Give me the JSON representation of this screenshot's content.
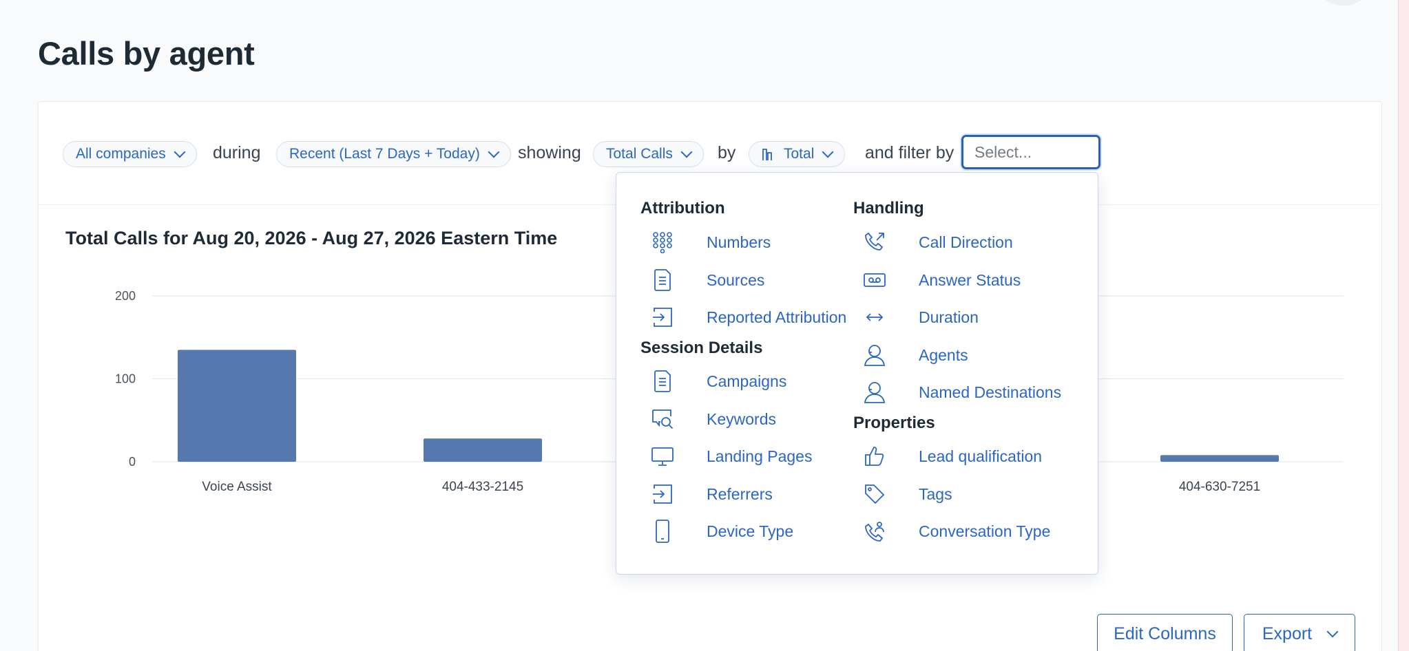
{
  "page": {
    "title": "Calls by agent"
  },
  "filters": {
    "company": "All companies",
    "during_label": "during",
    "date_range": "Recent (Last 7 Days + Today)",
    "showing_label": "showing",
    "metric": "Total Calls",
    "by_label": "by",
    "group": "Total",
    "filter_label": "and filter by",
    "select_placeholder": "Select..."
  },
  "dropdown": {
    "sections": {
      "attribution": "Attribution",
      "session_details": "Session Details",
      "handling": "Handling",
      "properties": "Properties"
    },
    "attribution_items": [
      {
        "label": "Numbers",
        "icon": "numbers-grid-icon"
      },
      {
        "label": "Sources",
        "icon": "document-icon"
      },
      {
        "label": "Reported Attribution",
        "icon": "sign-in-arrow-icon"
      }
    ],
    "session_items": [
      {
        "label": "Campaigns",
        "icon": "document-icon"
      },
      {
        "label": "Keywords",
        "icon": "search-chat-icon"
      },
      {
        "label": "Landing Pages",
        "icon": "monitor-icon"
      },
      {
        "label": "Referrers",
        "icon": "sign-in-arrow-icon"
      },
      {
        "label": "Device Type",
        "icon": "mobile-phone-icon"
      }
    ],
    "handling_items": [
      {
        "label": "Call Direction",
        "icon": "phone-outgoing-icon"
      },
      {
        "label": "Answer Status",
        "icon": "voicemail-icon"
      },
      {
        "label": "Duration",
        "icon": "double-arrow-icon"
      },
      {
        "label": "Agents",
        "icon": "agent-user-icon"
      },
      {
        "label": "Named Destinations",
        "icon": "agent-user-icon"
      }
    ],
    "properties_items": [
      {
        "label": "Lead qualification",
        "icon": "thumbs-up-icon"
      },
      {
        "label": "Tags",
        "icon": "tag-icon"
      },
      {
        "label": "Conversation Type",
        "icon": "phone-person-icon"
      }
    ]
  },
  "chart_data": {
    "type": "bar",
    "title": "Total Calls for Aug 20, 2026 - Aug 27, 2026 Eastern Time",
    "categories": [
      "Voice Assist",
      "404-433-2145",
      "404-630-7251"
    ],
    "values": [
      135,
      28,
      8
    ],
    "yticks": [
      0,
      100,
      200
    ],
    "ylim": [
      0,
      200
    ],
    "grid": true,
    "color": "#5578ae"
  },
  "actions": {
    "edit_columns": "Edit Columns",
    "export": "Export"
  }
}
